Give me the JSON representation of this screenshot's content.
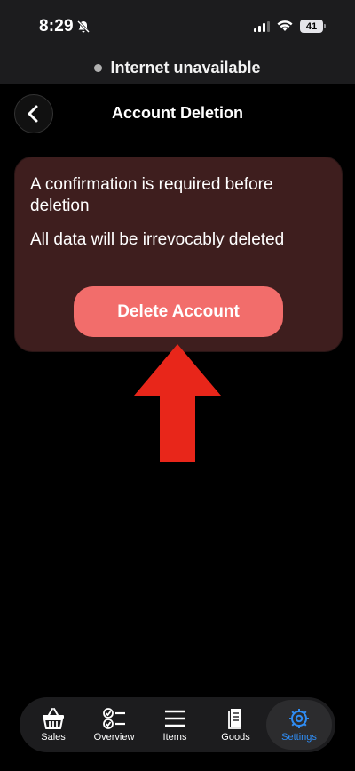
{
  "status_bar": {
    "time": "8:29",
    "battery": "41",
    "icons": [
      "bell-slash-icon",
      "signal-icon",
      "wifi-icon",
      "battery-icon"
    ]
  },
  "banner": {
    "text": "Internet unavailable"
  },
  "header": {
    "title": "Account Deletion",
    "back_icon": "chevron-left-icon"
  },
  "card": {
    "confirmation_text": "A confirmation is required before deletion",
    "warning_text": "All data will be irrevocably deleted",
    "delete_button_label": "Delete Account"
  },
  "tabs": [
    {
      "label": "Sales",
      "icon": "basket-icon",
      "active": false
    },
    {
      "label": "Overview",
      "icon": "checklist-icon",
      "active": false
    },
    {
      "label": "Items",
      "icon": "menu-icon",
      "active": false
    },
    {
      "label": "Goods",
      "icon": "document-icon",
      "active": false
    },
    {
      "label": "Settings",
      "icon": "gear-icon",
      "active": true
    }
  ],
  "colors": {
    "background": "#000000",
    "card_background": "#3e1e1e",
    "delete_button": "#f26d6b",
    "arrow": "#e8261a",
    "active_tab": "#2f8df5"
  }
}
